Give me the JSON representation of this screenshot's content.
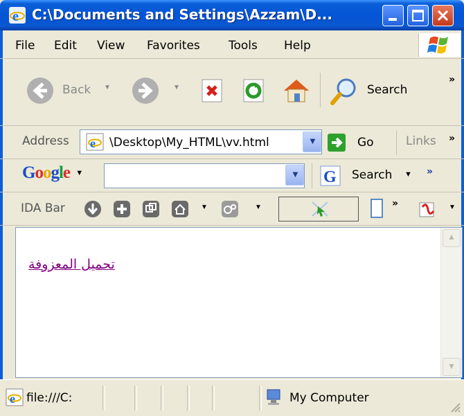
{
  "window": {
    "title": "C:\\Documents and Settings\\Azzam\\D..."
  },
  "menu": [
    "File",
    "Edit",
    "View",
    "Favorites",
    "Tools",
    "Help"
  ],
  "toolbar": {
    "back_label": "Back",
    "search_label": "Search",
    "more": "»"
  },
  "address": {
    "label": "Address",
    "value": "\\Desktop\\My_HTML\\vv.html",
    "go_label": "Go",
    "links_label": "Links",
    "more": "»"
  },
  "google": {
    "logo_letters": [
      "G",
      "o",
      "o",
      "g",
      "l",
      "e"
    ],
    "logo_colors": [
      "#1a4ec8",
      "#d6302c",
      "#e8a900",
      "#1a4ec8",
      "#129e3c",
      "#d6302c"
    ],
    "search_label": "Search",
    "more": "»"
  },
  "ida": {
    "label": "IDA Bar",
    "more": "»"
  },
  "content": {
    "link_text": "تحميل المعزوفة",
    "link_color": "#800080"
  },
  "status": {
    "url": "file:///C:",
    "zone": "My Computer"
  }
}
